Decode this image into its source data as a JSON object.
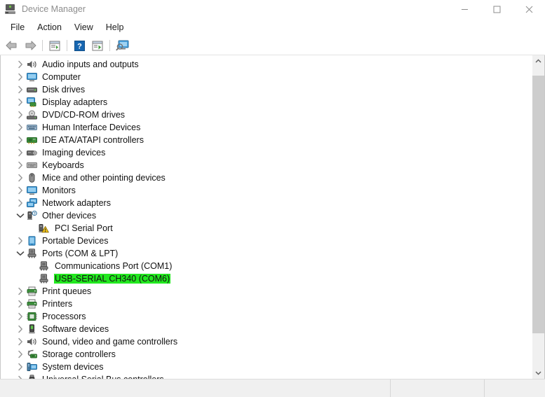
{
  "window": {
    "title": "Device Manager",
    "app_icon": "device-manager-icon",
    "controls": [
      {
        "name": "minimize-button",
        "glyph": "minimize"
      },
      {
        "name": "maximize-button",
        "glyph": "maximize"
      },
      {
        "name": "close-button",
        "glyph": "close"
      }
    ]
  },
  "menubar": {
    "items": [
      {
        "label": "File"
      },
      {
        "label": "Action"
      },
      {
        "label": "View"
      },
      {
        "label": "Help"
      }
    ]
  },
  "toolbar": {
    "buttons": [
      {
        "name": "back-button",
        "icon": "back-arrow-icon"
      },
      {
        "name": "forward-button",
        "icon": "forward-arrow-icon"
      },
      {
        "name": "separator-1",
        "icon": "separator"
      },
      {
        "name": "properties-button",
        "icon": "properties-icon"
      },
      {
        "name": "separator-2",
        "icon": "separator"
      },
      {
        "name": "help-button",
        "icon": "help-question-icon"
      },
      {
        "name": "update-driver-button",
        "icon": "update-driver-icon"
      },
      {
        "name": "separator-3",
        "icon": "separator"
      },
      {
        "name": "scan-hardware-changes-button",
        "icon": "scan-monitor-icon"
      }
    ]
  },
  "tree": {
    "items": [
      {
        "label": "Audio inputs and outputs",
        "level": 0,
        "state": "collapsed",
        "icon": "speaker-icon",
        "highlighted": false
      },
      {
        "label": "Computer",
        "level": 0,
        "state": "collapsed",
        "icon": "monitor-icon",
        "highlighted": false
      },
      {
        "label": "Disk drives",
        "level": 0,
        "state": "collapsed",
        "icon": "disk-drive-icon",
        "highlighted": false
      },
      {
        "label": "Display adapters",
        "level": 0,
        "state": "collapsed",
        "icon": "display-adapter-icon",
        "highlighted": false
      },
      {
        "label": "DVD/CD-ROM drives",
        "level": 0,
        "state": "collapsed",
        "icon": "dvd-drive-icon",
        "highlighted": false
      },
      {
        "label": "Human Interface Devices",
        "level": 0,
        "state": "collapsed",
        "icon": "hid-icon",
        "highlighted": false
      },
      {
        "label": "IDE ATA/ATAPI controllers",
        "level": 0,
        "state": "collapsed",
        "icon": "ide-controller-icon",
        "highlighted": false
      },
      {
        "label": "Imaging devices",
        "level": 0,
        "state": "collapsed",
        "icon": "camera-icon",
        "highlighted": false
      },
      {
        "label": "Keyboards",
        "level": 0,
        "state": "collapsed",
        "icon": "keyboard-icon",
        "highlighted": false
      },
      {
        "label": "Mice and other pointing devices",
        "level": 0,
        "state": "collapsed",
        "icon": "mouse-icon",
        "highlighted": false
      },
      {
        "label": "Monitors",
        "level": 0,
        "state": "collapsed",
        "icon": "monitor-icon",
        "highlighted": false
      },
      {
        "label": "Network adapters",
        "level": 0,
        "state": "collapsed",
        "icon": "network-adapter-icon",
        "highlighted": false
      },
      {
        "label": "Other devices",
        "level": 0,
        "state": "expanded",
        "icon": "unknown-device-icon",
        "highlighted": false
      },
      {
        "label": "PCI Serial Port",
        "level": 1,
        "state": "leaf",
        "icon": "warning-device-icon",
        "highlighted": false
      },
      {
        "label": "Portable Devices",
        "level": 0,
        "state": "collapsed",
        "icon": "portable-device-icon",
        "highlighted": false
      },
      {
        "label": "Ports (COM & LPT)",
        "level": 0,
        "state": "expanded",
        "icon": "port-icon",
        "highlighted": false
      },
      {
        "label": "Communications Port (COM1)",
        "level": 1,
        "state": "leaf",
        "icon": "port-icon",
        "highlighted": false
      },
      {
        "label": "USB-SERIAL CH340 (COM6)",
        "level": 1,
        "state": "leaf",
        "icon": "port-icon",
        "highlighted": true
      },
      {
        "label": "Print queues",
        "level": 0,
        "state": "collapsed",
        "icon": "printer-queue-icon",
        "highlighted": false
      },
      {
        "label": "Printers",
        "level": 0,
        "state": "collapsed",
        "icon": "printer-icon",
        "highlighted": false
      },
      {
        "label": "Processors",
        "level": 0,
        "state": "collapsed",
        "icon": "processor-icon",
        "highlighted": false
      },
      {
        "label": "Software devices",
        "level": 0,
        "state": "collapsed",
        "icon": "software-device-icon",
        "highlighted": false
      },
      {
        "label": "Sound, video and game controllers",
        "level": 0,
        "state": "collapsed",
        "icon": "speaker-icon",
        "highlighted": false
      },
      {
        "label": "Storage controllers",
        "level": 0,
        "state": "collapsed",
        "icon": "storage-controller-icon",
        "highlighted": false
      },
      {
        "label": "System devices",
        "level": 0,
        "state": "collapsed",
        "icon": "system-device-icon",
        "highlighted": false
      },
      {
        "label": "Universal Serial Bus controllers",
        "level": 0,
        "state": "collapsed",
        "icon": "usb-icon",
        "highlighted": false
      }
    ],
    "selected_label": "USB-SERIAL CH340 (COM6)",
    "highlight_color": "#22e81f"
  },
  "scrollbar": {
    "name": "vertical-scrollbar",
    "up_arrow": "chevron-up-icon",
    "down_arrow": "chevron-down-icon"
  },
  "statusbar": {
    "panes": [
      "",
      "",
      ""
    ]
  }
}
